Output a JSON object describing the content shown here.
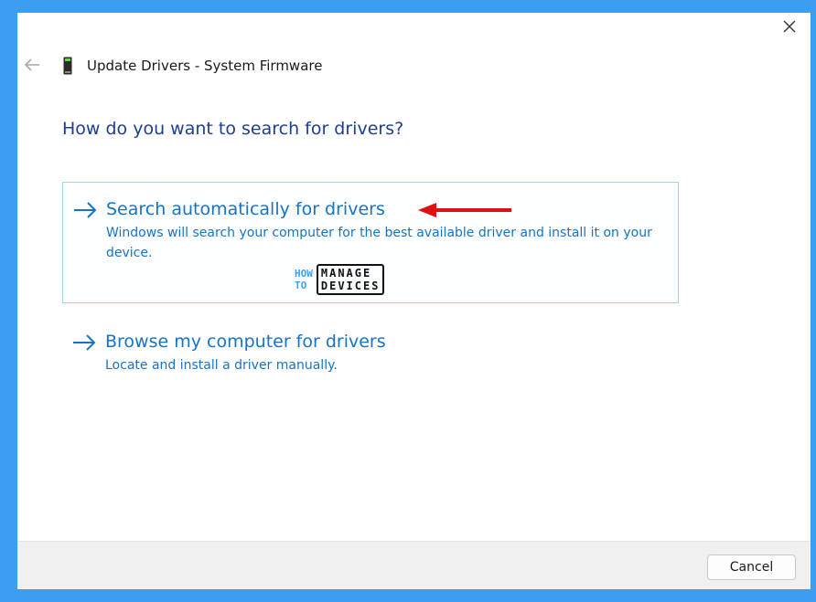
{
  "window": {
    "title": "Update Drivers - System Firmware",
    "heading": "How do you want to search for drivers?"
  },
  "options": [
    {
      "title": "Search automatically for drivers",
      "description": "Windows will search your computer for the best available driver and install it on your device."
    },
    {
      "title": "Browse my computer for drivers",
      "description": "Locate and install a driver manually."
    }
  ],
  "watermark": {
    "line1_left": "HOW",
    "line2_left": "TO",
    "line1_right": "MANAGE",
    "line2_right": "DEVICES"
  },
  "footer": {
    "cancel_label": "Cancel"
  },
  "icons": {
    "close": "close-icon",
    "back": "back-arrow-icon",
    "device": "device-icon",
    "option_arrow": "right-arrow-icon",
    "annotation": "red-arrow-icon"
  },
  "colors": {
    "frame": "#3d9ef0",
    "heading": "#1e3f8f",
    "link": "#1773c6",
    "selected_border": "#a7d2ee",
    "annotation": "#e01010"
  }
}
